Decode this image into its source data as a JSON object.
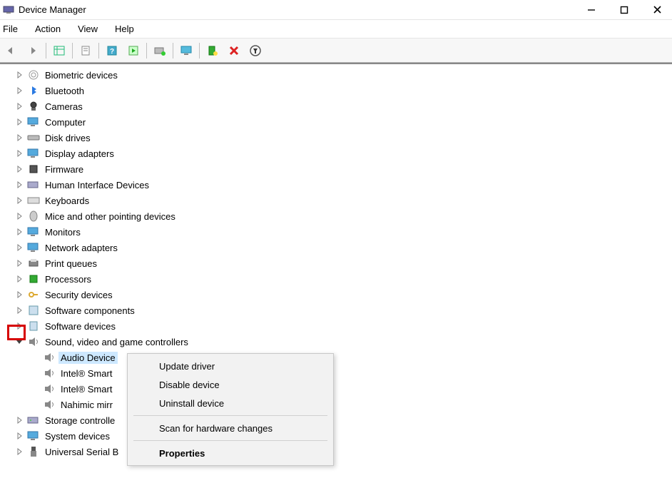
{
  "window": {
    "title": "Device Manager"
  },
  "menus": [
    "File",
    "Action",
    "View",
    "Help"
  ],
  "toolbar_icons": [
    "back-icon",
    "forward-icon",
    "show-hidden-icon",
    "properties-icon",
    "help-icon",
    "play-icon",
    "add-legacy-icon",
    "monitor-icon",
    "scan-icon",
    "remove-icon",
    "update-driver-icon"
  ],
  "tree": {
    "items": [
      {
        "label": "Biometric devices",
        "icon": "fingerprint"
      },
      {
        "label": "Bluetooth",
        "icon": "bluetooth"
      },
      {
        "label": "Cameras",
        "icon": "camera"
      },
      {
        "label": "Computer",
        "icon": "computer"
      },
      {
        "label": "Disk drives",
        "icon": "disk"
      },
      {
        "label": "Display adapters",
        "icon": "display"
      },
      {
        "label": "Firmware",
        "icon": "chip"
      },
      {
        "label": "Human Interface Devices",
        "icon": "hid"
      },
      {
        "label": "Keyboards",
        "icon": "keyboard"
      },
      {
        "label": "Mice and other pointing devices",
        "icon": "mouse"
      },
      {
        "label": "Monitors",
        "icon": "monitor"
      },
      {
        "label": "Network adapters",
        "icon": "network"
      },
      {
        "label": "Print queues",
        "icon": "printer"
      },
      {
        "label": "Processors",
        "icon": "cpu"
      },
      {
        "label": "Security devices",
        "icon": "key"
      },
      {
        "label": "Software components",
        "icon": "component"
      },
      {
        "label": "Software devices",
        "icon": "software"
      },
      {
        "label": "Sound, video and game controllers",
        "icon": "speaker",
        "expanded": true,
        "children": [
          {
            "label": "Audio Device",
            "selected": true
          },
          {
            "label": "Intel® Smart"
          },
          {
            "label": "Intel® Smart"
          },
          {
            "label": "Nahimic mirr"
          }
        ]
      },
      {
        "label": "Storage controlle",
        "icon": "storage"
      },
      {
        "label": "System devices",
        "icon": "system"
      },
      {
        "label": "Universal Serial B",
        "icon": "usb"
      }
    ]
  },
  "context_menu": {
    "items": [
      {
        "label": "Update driver",
        "highlighted": true
      },
      {
        "label": "Disable device"
      },
      {
        "label": "Uninstall device"
      },
      {
        "sep": true
      },
      {
        "label": "Scan for hardware changes"
      },
      {
        "sep": true
      },
      {
        "label": "Properties",
        "bold": true
      }
    ]
  }
}
